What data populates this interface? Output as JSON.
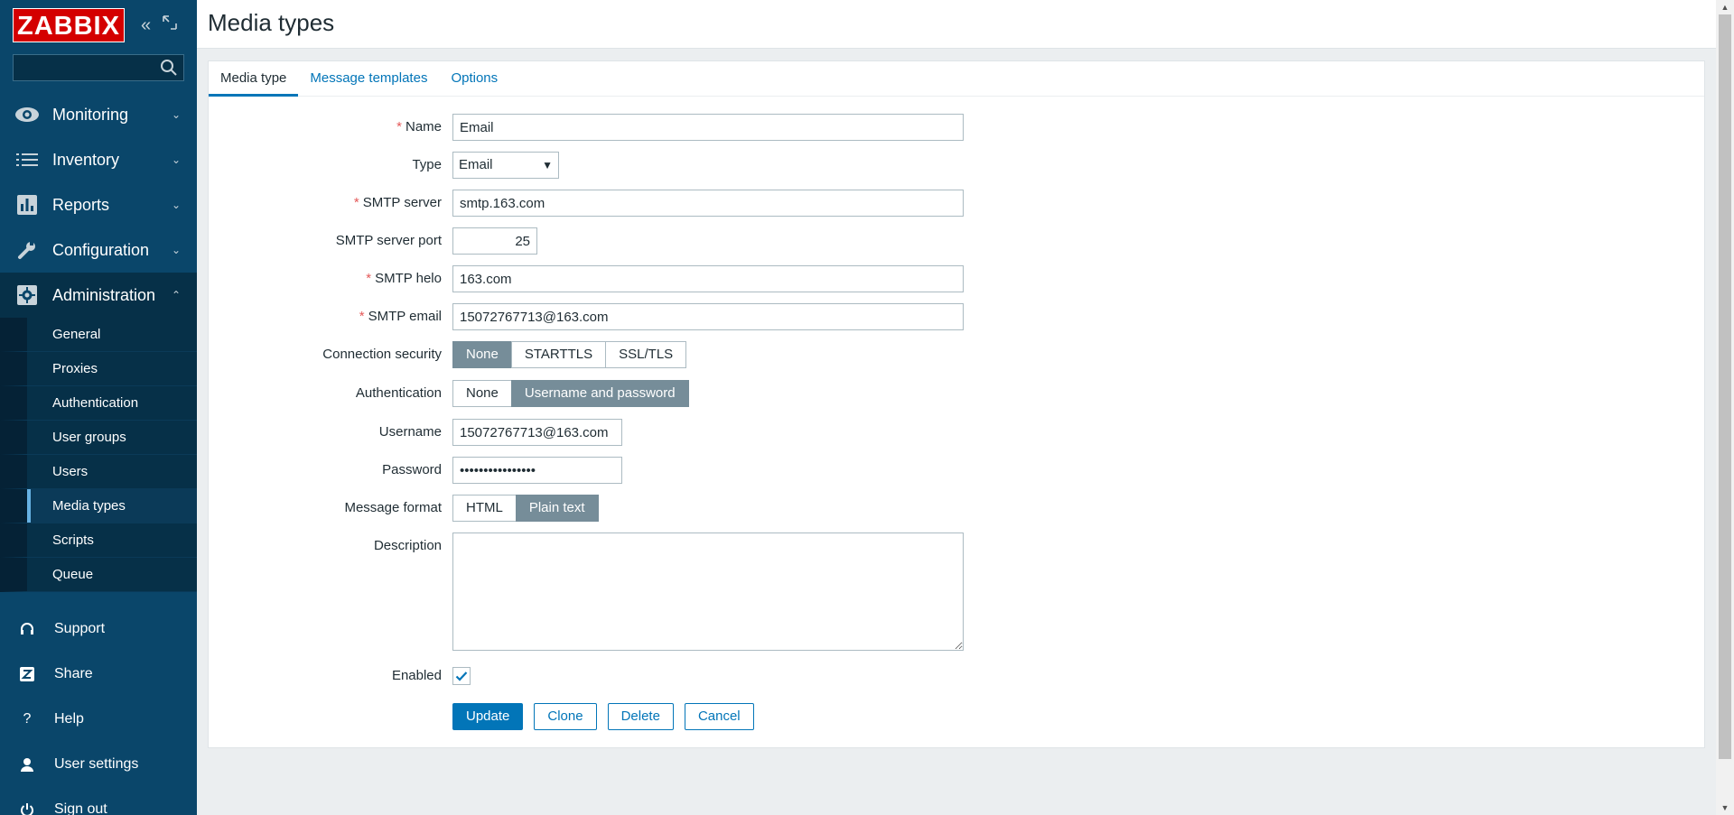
{
  "logo": "ZABBIX",
  "search": {
    "placeholder": ""
  },
  "menu": [
    {
      "label": "Monitoring",
      "icon": "eye-icon"
    },
    {
      "label": "Inventory",
      "icon": "list-icon"
    },
    {
      "label": "Reports",
      "icon": "bar-chart-icon"
    },
    {
      "label": "Configuration",
      "icon": "wrench-icon"
    },
    {
      "label": "Administration",
      "icon": "gear-icon"
    }
  ],
  "submenu": [
    "General",
    "Proxies",
    "Authentication",
    "User groups",
    "Users",
    "Media types",
    "Scripts",
    "Queue"
  ],
  "bottom_menu": [
    {
      "label": "Support",
      "icon": "headset-icon"
    },
    {
      "label": "Share",
      "icon": "share-icon"
    },
    {
      "label": "Help",
      "icon": "help-icon"
    },
    {
      "label": "User settings",
      "icon": "user-icon"
    },
    {
      "label": "Sign out",
      "icon": "power-icon"
    }
  ],
  "page_title": "Media types",
  "tabs": [
    "Media type",
    "Message templates",
    "Options"
  ],
  "form": {
    "name_label": "Name",
    "name_value": "Email",
    "type_label": "Type",
    "type_value": "Email",
    "smtp_server_label": "SMTP server",
    "smtp_server_value": "smtp.163.com",
    "smtp_port_label": "SMTP server port",
    "smtp_port_value": "25",
    "smtp_helo_label": "SMTP helo",
    "smtp_helo_value": "163.com",
    "smtp_email_label": "SMTP email",
    "smtp_email_value": "15072767713@163.com",
    "conn_security_label": "Connection security",
    "conn_security_options": [
      "None",
      "STARTTLS",
      "SSL/TLS"
    ],
    "conn_security_selected": "None",
    "auth_label": "Authentication",
    "auth_options": [
      "None",
      "Username and password"
    ],
    "auth_selected": "Username and password",
    "username_label": "Username",
    "username_value": "15072767713@163.com",
    "password_label": "Password",
    "password_value": "••••••••••••••••",
    "msg_format_label": "Message format",
    "msg_format_options": [
      "HTML",
      "Plain text"
    ],
    "msg_format_selected": "Plain text",
    "description_label": "Description",
    "description_value": "",
    "enabled_label": "Enabled",
    "enabled": true
  },
  "buttons": {
    "update": "Update",
    "clone": "Clone",
    "delete": "Delete",
    "cancel": "Cancel"
  },
  "colors": {
    "sidebar": "#0a466a",
    "logo": "#d40000",
    "accent": "#0275b8",
    "toggle_on": "#768d99",
    "required": "#e45959"
  }
}
